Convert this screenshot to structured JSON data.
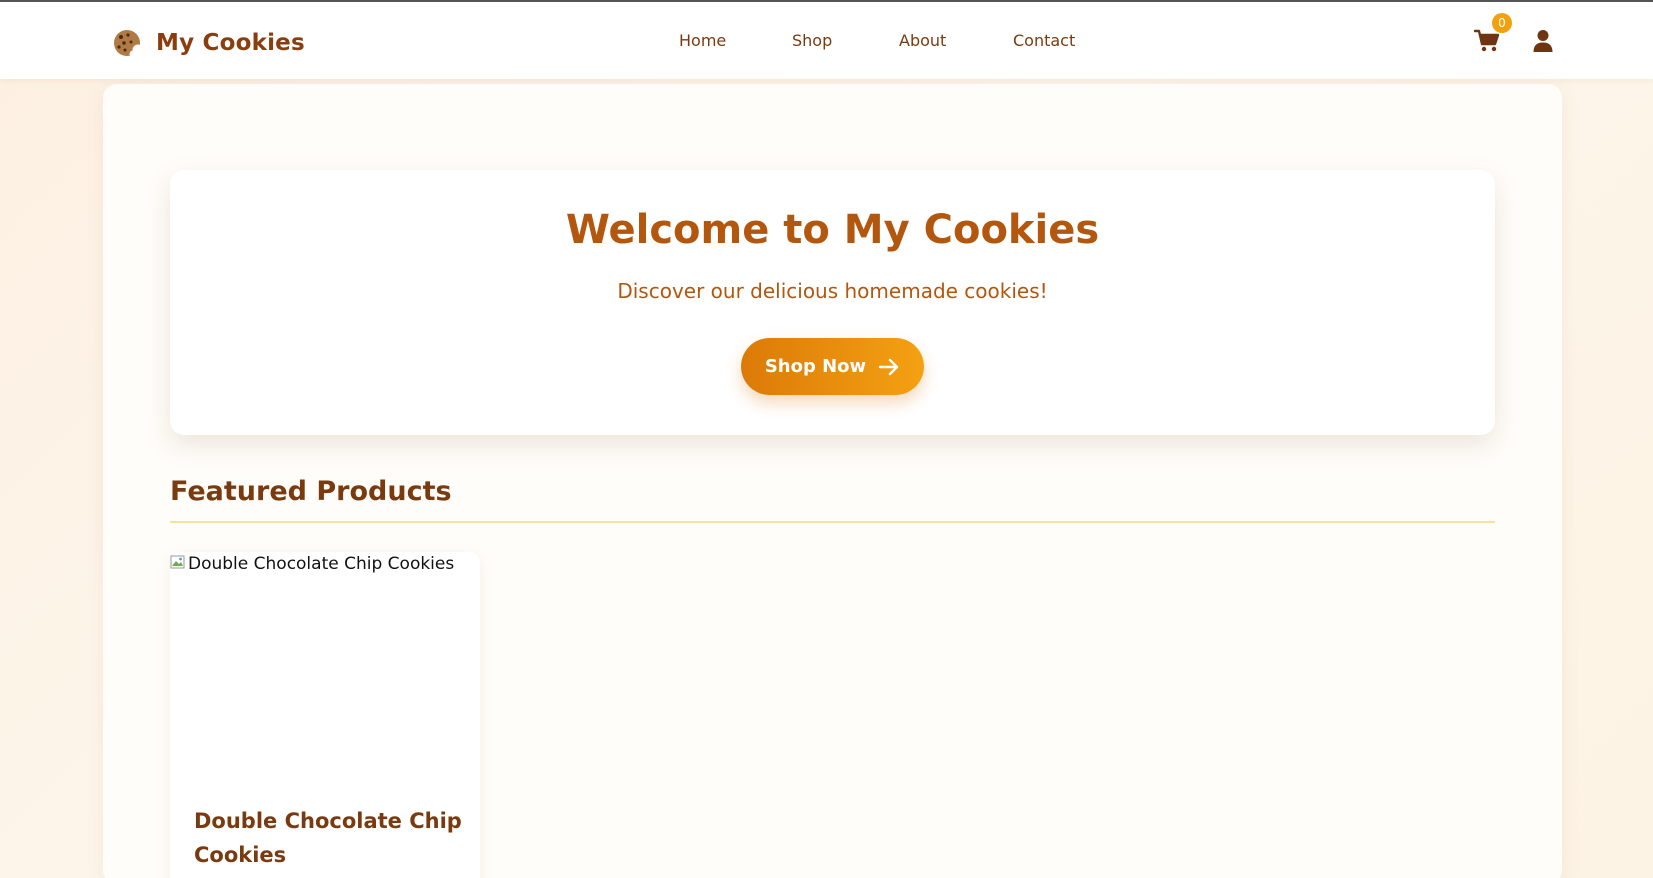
{
  "brand": {
    "name": "My Cookies",
    "icon": "cookie-icon"
  },
  "nav": {
    "links": [
      {
        "label": "Home"
      },
      {
        "label": "Shop"
      },
      {
        "label": "About"
      },
      {
        "label": "Contact"
      }
    ]
  },
  "header_actions": {
    "cart_icon": "shopping-cart-icon",
    "cart_count": "0",
    "user_icon": "user-icon"
  },
  "hero": {
    "title": "Welcome to My Cookies",
    "subtitle": "Discover our delicious homemade cookies!",
    "cta_label": "Shop Now",
    "cta_icon": "arrow-right-icon"
  },
  "featured": {
    "title": "Featured Products",
    "products": [
      {
        "image_alt": "Double Chocolate Chip Cookies",
        "name": "Double Chocolate Chip Cookies"
      }
    ]
  },
  "colors": {
    "brand_brown": "#8a3d0e",
    "accent_orange": "#f1a10d",
    "hero_text": "#b4570e",
    "divider_yellow": "#f6e39a"
  }
}
